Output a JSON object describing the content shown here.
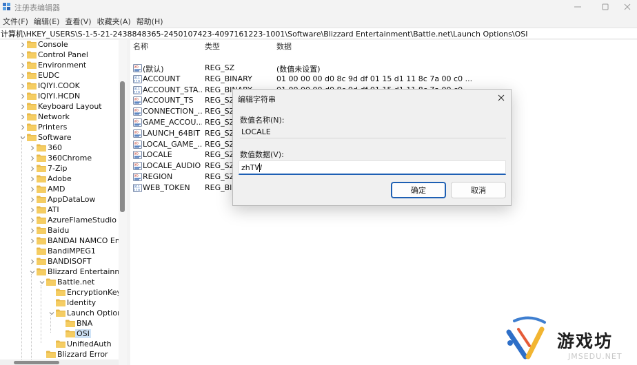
{
  "window": {
    "title": "注册表编辑器"
  },
  "menu": [
    {
      "label": "文件(F)"
    },
    {
      "label": "编辑(E)"
    },
    {
      "label": "查看(V)"
    },
    {
      "label": "收藏夹(A)"
    },
    {
      "label": "帮助(H)"
    }
  ],
  "address": "计算机\\HKEY_USERS\\S-1-5-21-2438848365-2450107423-4097161223-1001\\Software\\Blizzard Entertainment\\Battle.net\\Launch Options\\OSI",
  "tree": [
    {
      "label": "Console",
      "level": 0,
      "expand": "collapsed"
    },
    {
      "label": "Control Panel",
      "level": 0,
      "expand": "collapsed"
    },
    {
      "label": "Environment",
      "level": 0,
      "expand": "collapsed"
    },
    {
      "label": "EUDC",
      "level": 0,
      "expand": "collapsed"
    },
    {
      "label": "IQIYI.COOK",
      "level": 0,
      "expand": "collapsed"
    },
    {
      "label": "IQIYI.HCDN",
      "level": 0,
      "expand": "collapsed"
    },
    {
      "label": "Keyboard Layout",
      "level": 0,
      "expand": "collapsed"
    },
    {
      "label": "Network",
      "level": 0,
      "expand": "collapsed"
    },
    {
      "label": "Printers",
      "level": 0,
      "expand": "collapsed"
    },
    {
      "label": "Software",
      "level": 0,
      "expand": "expanded"
    },
    {
      "label": "360",
      "level": 1,
      "expand": "collapsed"
    },
    {
      "label": "360Chrome",
      "level": 1,
      "expand": "collapsed"
    },
    {
      "label": "7-Zip",
      "level": 1,
      "expand": "collapsed"
    },
    {
      "label": "Adobe",
      "level": 1,
      "expand": "collapsed"
    },
    {
      "label": "AMD",
      "level": 1,
      "expand": "collapsed"
    },
    {
      "label": "AppDataLow",
      "level": 1,
      "expand": "collapsed"
    },
    {
      "label": "ATI",
      "level": 1,
      "expand": "collapsed"
    },
    {
      "label": "AzureFlameStudio",
      "level": 1,
      "expand": "collapsed"
    },
    {
      "label": "Baidu",
      "level": 1,
      "expand": "collapsed"
    },
    {
      "label": "BANDAI NAMCO En",
      "level": 1,
      "expand": "collapsed"
    },
    {
      "label": "BandiMPEG1",
      "level": 1,
      "expand": "none"
    },
    {
      "label": "BANDISOFT",
      "level": 1,
      "expand": "collapsed"
    },
    {
      "label": "Blizzard Entertainme",
      "level": 1,
      "expand": "expanded"
    },
    {
      "label": "Battle.net",
      "level": 2,
      "expand": "expanded"
    },
    {
      "label": "EncryptionKey",
      "level": 3,
      "expand": "none"
    },
    {
      "label": "Identity",
      "level": 3,
      "expand": "none"
    },
    {
      "label": "Launch Option",
      "level": 3,
      "expand": "expanded"
    },
    {
      "label": "BNA",
      "level": 4,
      "expand": "none"
    },
    {
      "label": "OSI",
      "level": 4,
      "expand": "none",
      "selected": true
    },
    {
      "label": "UnifiedAuth",
      "level": 3,
      "expand": "none"
    },
    {
      "label": "Blizzard Error",
      "level": 2,
      "expand": "none"
    }
  ],
  "list": {
    "headers": {
      "name": "名称",
      "type": "类型",
      "data": "数据"
    },
    "rows": [
      {
        "name": "(默认)",
        "type": "REG_SZ",
        "data": "(数值未设置)",
        "icon": "string-value-icon"
      },
      {
        "name": "ACCOUNT",
        "type": "REG_BINARY",
        "data": "01 00 00 00 d0 8c 9d df 01 15 d1 11 8c 7a 00 c0 ...",
        "icon": "binary-value-icon"
      },
      {
        "name": "ACCOUNT_STA...",
        "type": "REG_BINARY",
        "data": "01 00 00 00 d0 8c 9d df 01 15 d1 11 8c 7a 00 c0 ...",
        "icon": "binary-value-icon"
      },
      {
        "name": "ACCOUNT_TS",
        "type": "REG_SZ",
        "data": "",
        "icon": "string-value-icon"
      },
      {
        "name": "CONNECTION_...",
        "type": "REG_SZ",
        "data": "",
        "icon": "string-value-icon"
      },
      {
        "name": "GAME_ACCOU...",
        "type": "REG_SZ",
        "data": "",
        "icon": "string-value-icon"
      },
      {
        "name": "LAUNCH_64BIT",
        "type": "REG_SZ",
        "data": "",
        "icon": "string-value-icon"
      },
      {
        "name": "LOCAL_GAME_...",
        "type": "REG_SZ",
        "data": "",
        "icon": "string-value-icon"
      },
      {
        "name": "LOCALE",
        "type": "REG_SZ",
        "data": "",
        "icon": "string-value-icon"
      },
      {
        "name": "LOCALE_AUDIO",
        "type": "REG_SZ",
        "data": "",
        "icon": "string-value-icon"
      },
      {
        "name": "REGION",
        "type": "REG_SZ",
        "data": "",
        "icon": "string-value-icon"
      },
      {
        "name": "WEB_TOKEN",
        "type": "REG_BIN",
        "data": "",
        "icon": "binary-value-icon"
      }
    ]
  },
  "dialog": {
    "title": "编辑字符串",
    "name_label": "数值名称(N):",
    "name_value": "LOCALE",
    "data_label": "数值数据(V):",
    "data_value": "zhTW",
    "ok_label": "确定",
    "cancel_label": "取消"
  },
  "watermark": {
    "text": "游戏坊",
    "sub": "JMSEDU.NET"
  },
  "colors": {
    "accent": "#1e5fb4",
    "folder": "#e8b94a",
    "selection": "#cfe3f7"
  }
}
